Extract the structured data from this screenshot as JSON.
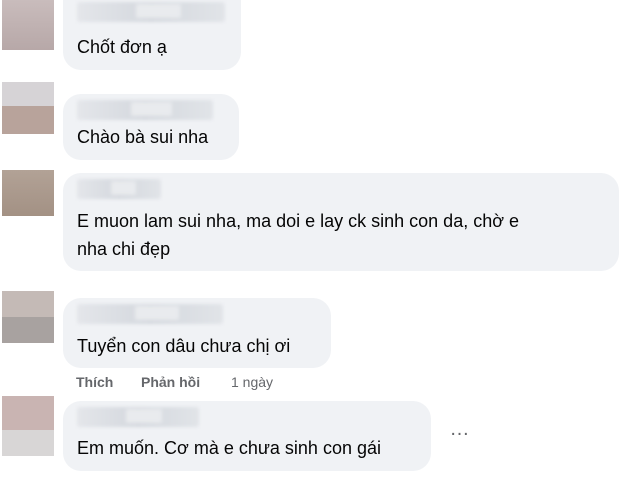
{
  "comments": [
    {
      "text": "Chốt đơn ạ"
    },
    {
      "text": "Chào bà sui nha"
    },
    {
      "text_line1": "E muon lam sui nha, ma doi e lay ck sinh con da, chờ e",
      "text_line2": "nha chi đẹp"
    },
    {
      "text": "Tuyển con dâu chưa chị ơi",
      "actions": {
        "like": "Thích",
        "reply": "Phản hồi",
        "time": "1 ngày"
      }
    },
    {
      "text": "Em muốn. Cơ mà e chưa sinh con gái"
    }
  ],
  "more_options": "…",
  "colors": {
    "bubble": "#f0f2f5",
    "text": "#050505",
    "secondary_text": "#65676b"
  }
}
